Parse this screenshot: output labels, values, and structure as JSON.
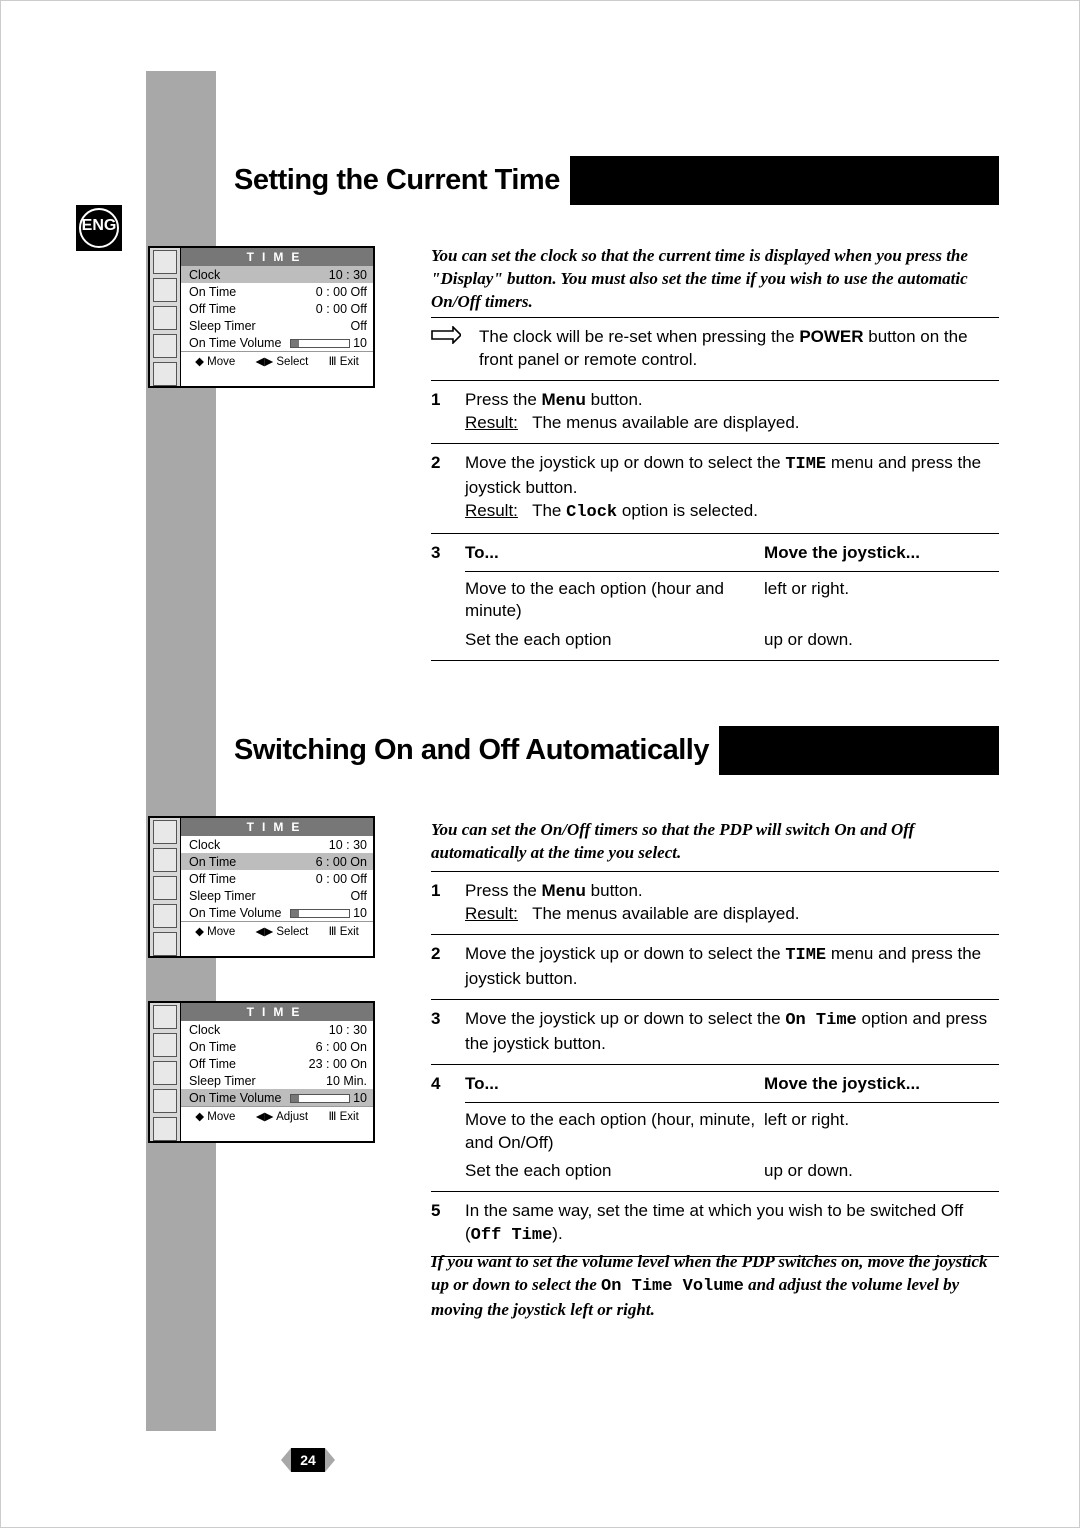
{
  "lang_badge": "ENG",
  "page_number": "24",
  "title1": "Setting the Current Time",
  "title2": "Switching On and Off Automatically",
  "intro1": "You can set the clock so that the current time is displayed when you press the \"Display\" button. You must also set the time if you wish to use the automatic On/Off timers.",
  "note1_a": "The clock will be re-set when pressing the ",
  "note1_b": "POWER",
  "note1_c": " button on the front panel or remote control.",
  "s1": {
    "r1_a": "Press the ",
    "r1_b": "Menu",
    "r1_c": " button.",
    "r1_res_l": "Result:",
    "r1_res_t": "The menus available are displayed.",
    "r2_a": "Move the joystick up or down to select the ",
    "r2_mono": "TIME",
    "r2_b": " menu and press the joystick button.",
    "r2_res_l": "Result:",
    "r2_res_t_a": "The ",
    "r2_res_mono": "Clock",
    "r2_res_t_b": " option is selected.",
    "r3_to": "To...",
    "r3_mt": "Move the joystick...",
    "r3a_c1": "Move to the each option (hour and minute)",
    "r3a_c2": "left or right.",
    "r3b_c1": "Set the each option",
    "r3b_c2": "up or down."
  },
  "intro2": "You can set the On/Off timers so that the PDP will switch On and Off automatically at the time you select.",
  "s2": {
    "r1_a": "Press the ",
    "r1_b": "Menu",
    "r1_c": " button.",
    "r1_res_l": "Result:",
    "r1_res_t": "The menus available are displayed.",
    "r2_a": "Move the joystick up or down to select the ",
    "r2_mono": "TIME",
    "r2_b": " menu and press the joystick button.",
    "r3_a": "Move the joystick up or down to select the ",
    "r3_mono": "On Time",
    "r3_b": " option and press the joystick button.",
    "r4_to": "To...",
    "r4_mt": "Move the joystick...",
    "r4a_c1": "Move to the each option (hour, minute, and On/Off)",
    "r4a_c2": "left or right.",
    "r4b_c1": "Set the each option",
    "r4b_c2": "up or down.",
    "r5_a": "In the same way, set the time at which you wish to be switched Off (",
    "r5_mono": "Off Time",
    "r5_b": ")."
  },
  "outro_a": "If you want to set the volume level when the PDP switches on, move the joystick up or down to select the ",
  "outro_mono": "On Time Volume",
  "outro_b": " and adjust the volume level by moving the joystick left or right.",
  "osd": {
    "header": "TIME",
    "labels": {
      "clock": "Clock",
      "on": "On Time",
      "off": "Off Time",
      "sleep": "Sleep Timer",
      "vol": "On Time Volume",
      "volval": "10"
    },
    "foot": {
      "move": "Move",
      "select": "Select",
      "adjust": "Adjust",
      "exit": "Exit"
    },
    "a": {
      "clock": "10 : 30",
      "on": "0 : 00 Off",
      "off": "0 : 00 Off",
      "sleep": "Off",
      "sel": "clock"
    },
    "b": {
      "clock": "10 : 30",
      "on": "6 : 00 On",
      "off": "0 : 00 Off",
      "sleep": "Off",
      "sel": "on"
    },
    "c": {
      "clock": "10 : 30",
      "on": "6 : 00 On",
      "off": "23 : 00 On",
      "sleep": "10 Min.",
      "sel": "vol",
      "footmid": "adjust"
    }
  }
}
